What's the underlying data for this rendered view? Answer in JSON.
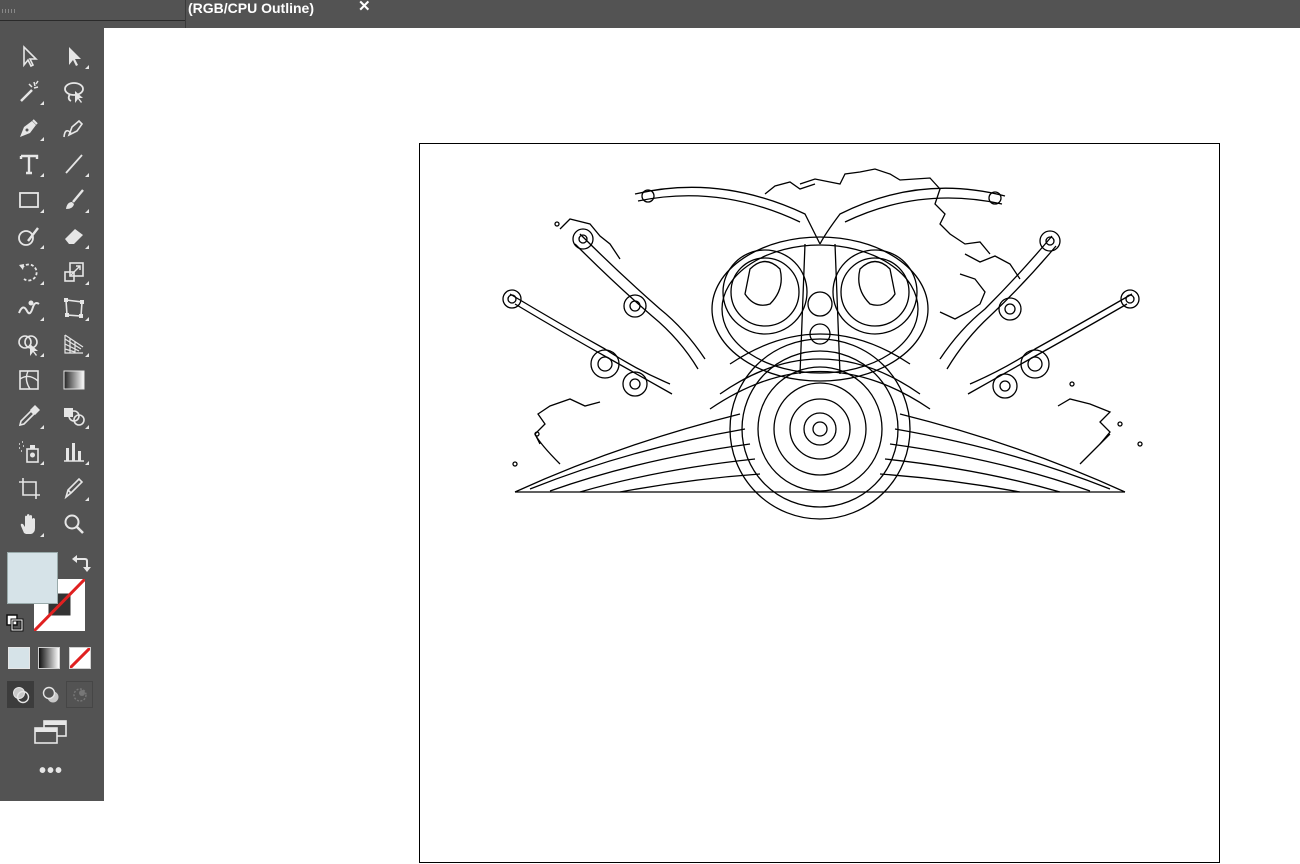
{
  "document_tab": {
    "title": "(RGB/CPU Outline)",
    "close_glyph": "✕"
  },
  "toolbar": {
    "tools": [
      {
        "name": "selection-tool",
        "icon": "selection-arrow-icon"
      },
      {
        "name": "direct-selection-tool",
        "icon": "direct-selection-arrow-icon"
      },
      {
        "name": "magic-wand-tool",
        "icon": "magic-wand-icon"
      },
      {
        "name": "lasso-tool",
        "icon": "lasso-icon"
      },
      {
        "name": "pen-tool",
        "icon": "pen-icon"
      },
      {
        "name": "curvature-tool",
        "icon": "curvature-icon"
      },
      {
        "name": "type-tool",
        "icon": "type-icon"
      },
      {
        "name": "line-segment-tool",
        "icon": "line-icon"
      },
      {
        "name": "rectangle-tool",
        "icon": "rectangle-icon"
      },
      {
        "name": "paintbrush-tool",
        "icon": "paintbrush-icon"
      },
      {
        "name": "shaper-tool",
        "icon": "shaper-icon"
      },
      {
        "name": "eraser-tool",
        "icon": "eraser-icon"
      },
      {
        "name": "rotate-tool",
        "icon": "rotate-icon"
      },
      {
        "name": "scale-tool",
        "icon": "scale-icon"
      },
      {
        "name": "warp-tool",
        "icon": "warp-icon"
      },
      {
        "name": "free-transform-tool",
        "icon": "free-transform-icon"
      },
      {
        "name": "shape-builder-tool",
        "icon": "shape-builder-icon"
      },
      {
        "name": "perspective-grid-tool",
        "icon": "perspective-grid-icon"
      },
      {
        "name": "mesh-tool",
        "icon": "mesh-icon"
      },
      {
        "name": "gradient-tool",
        "icon": "gradient-icon"
      },
      {
        "name": "eyedropper-tool",
        "icon": "eyedropper-icon"
      },
      {
        "name": "blend-tool",
        "icon": "blend-icon"
      },
      {
        "name": "symbol-sprayer-tool",
        "icon": "symbol-sprayer-icon"
      },
      {
        "name": "column-graph-tool",
        "icon": "column-graph-icon"
      },
      {
        "name": "artboard-tool",
        "icon": "artboard-icon"
      },
      {
        "name": "slice-tool",
        "icon": "slice-icon"
      },
      {
        "name": "hand-tool",
        "icon": "hand-icon"
      },
      {
        "name": "zoom-tool",
        "icon": "zoom-icon"
      }
    ],
    "fill_color": "#d6e3e8",
    "stroke_color": "none",
    "panel_color": "#535353",
    "more_label": "•••"
  },
  "canvas": {
    "pasteboard_color": "#ffffff",
    "artboard_color": "#ffffff",
    "artwork": "outline-view ornamental illustration"
  }
}
